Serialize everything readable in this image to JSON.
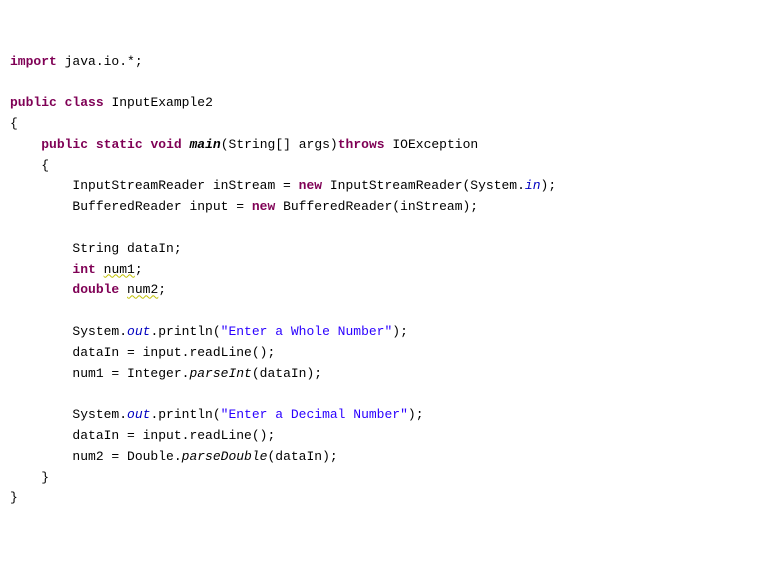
{
  "code": {
    "kw_import": "import",
    "import_pkg": " java.io.*;",
    "kw_public1": "public",
    "kw_class": "class",
    "classname": "InputExample2",
    "kw_public2": "public",
    "kw_static": "static",
    "kw_void": "void",
    "main": "main",
    "main_params": "(String[] args)",
    "kw_throws": "throws",
    "ioexc": " IOException",
    "isr1": "InputStreamReader inStream = ",
    "kw_new1": "new",
    "isr2": " InputStreamReader(System.",
    "sys_in": "in",
    "isr3": ");",
    "br1": "BufferedReader input = ",
    "kw_new2": "new",
    "br2": " BufferedReader(inStream);",
    "decl_str": "String dataIn;",
    "kw_int": "int",
    "num1_decl": "num1",
    "semi1": ";",
    "kw_double": "double",
    "num2_decl": "num2",
    "semi2": ";",
    "sys1": "System.",
    "out1": "out",
    "println1a": ".println(",
    "str1": "\"Enter a Whole Number\"",
    "println1b": ");",
    "read1": "dataIn = input.readLine();",
    "parse1a": "num1 = Integer.",
    "parseInt": "parseInt",
    "parse1b": "(dataIn);",
    "sys2": "System.",
    "out2": "out",
    "println2a": ".println(",
    "str2": "\"Enter a Decimal Number\"",
    "println2b": ");",
    "read2": "dataIn = input.readLine();",
    "parse2a": "num2 = Double.",
    "parseDouble": "parseDouble",
    "parse2b": "(dataIn);"
  }
}
